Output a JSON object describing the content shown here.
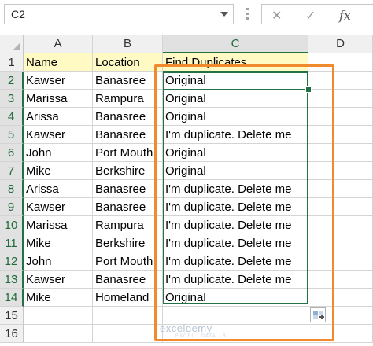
{
  "formula_bar": {
    "name_box": "C2",
    "cancel_glyph": "✕",
    "enter_glyph": "✓",
    "fx_glyph": "fx",
    "formula": ""
  },
  "columns": [
    "A",
    "B",
    "C",
    "D"
  ],
  "rows": [
    {
      "num": "1",
      "a": "Name",
      "b": "Location",
      "c": "Find Duplicates"
    },
    {
      "num": "2",
      "a": "Kawser",
      "b": "Banasree",
      "c": "Original"
    },
    {
      "num": "3",
      "a": "Marissa",
      "b": "Rampura",
      "c": "Original"
    },
    {
      "num": "4",
      "a": "Arissa",
      "b": "Banasree",
      "c": "Original"
    },
    {
      "num": "5",
      "a": "Kawser",
      "b": "Banasree",
      "c": "I'm duplicate. Delete me"
    },
    {
      "num": "6",
      "a": "John",
      "b": "Port Mouth",
      "c": "Original"
    },
    {
      "num": "7",
      "a": "Mike",
      "b": "Berkshire",
      "c": "Original"
    },
    {
      "num": "8",
      "a": "Arissa",
      "b": "Banasree",
      "c": "I'm duplicate. Delete me"
    },
    {
      "num": "9",
      "a": "Kawser",
      "b": "Banasree",
      "c": "I'm duplicate. Delete me"
    },
    {
      "num": "10",
      "a": "Marissa",
      "b": "Rampura",
      "c": "I'm duplicate. Delete me"
    },
    {
      "num": "11",
      "a": "Mike",
      "b": "Berkshire",
      "c": "I'm duplicate. Delete me"
    },
    {
      "num": "12",
      "a": "John",
      "b": "Port Mouth",
      "c": "I'm duplicate. Delete me"
    },
    {
      "num": "13",
      "a": "Kawser",
      "b": "Banasree",
      "c": "I'm duplicate. Delete me"
    },
    {
      "num": "14",
      "a": "Mike",
      "b": "Homeland",
      "c": "Original"
    },
    {
      "num": "15",
      "a": "",
      "b": "",
      "c": ""
    },
    {
      "num": "16",
      "a": "",
      "b": "",
      "c": ""
    }
  ],
  "watermark": {
    "brand": "exceldemy",
    "tagline": "EXCEL · DATA · BI"
  },
  "colors": {
    "header_fill": "#fff9c4",
    "selection": "#217346",
    "highlight_box": "#f08a2c"
  },
  "icons": {
    "quick_analysis": "quick-analysis-icon",
    "name_box_dropdown": "chevron-down-icon"
  }
}
